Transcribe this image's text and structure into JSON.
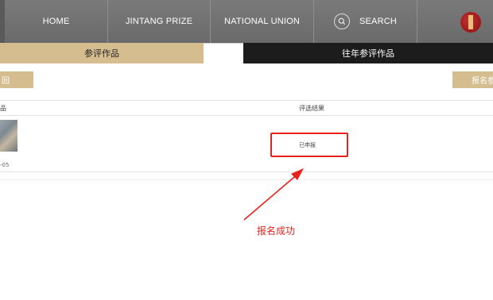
{
  "nav": {
    "items": [
      "HOME",
      "JINTANG PRIZE",
      "NATIONAL UNION"
    ],
    "search_label": "SEARCH"
  },
  "tabs": {
    "current": "参评作品",
    "past": "往年参评作品"
  },
  "actions": {
    "back": "回",
    "signup": "报名参"
  },
  "table": {
    "col_work": "品",
    "col_result": "评选结果"
  },
  "row": {
    "date": "-05",
    "status": "已申报"
  },
  "annotation": {
    "text": "报名成功",
    "color": "#e8211b"
  },
  "colors": {
    "nav_bg": "#737373",
    "tab_gold": "#d5bd8f",
    "tab_dark": "#1c1c1c"
  }
}
